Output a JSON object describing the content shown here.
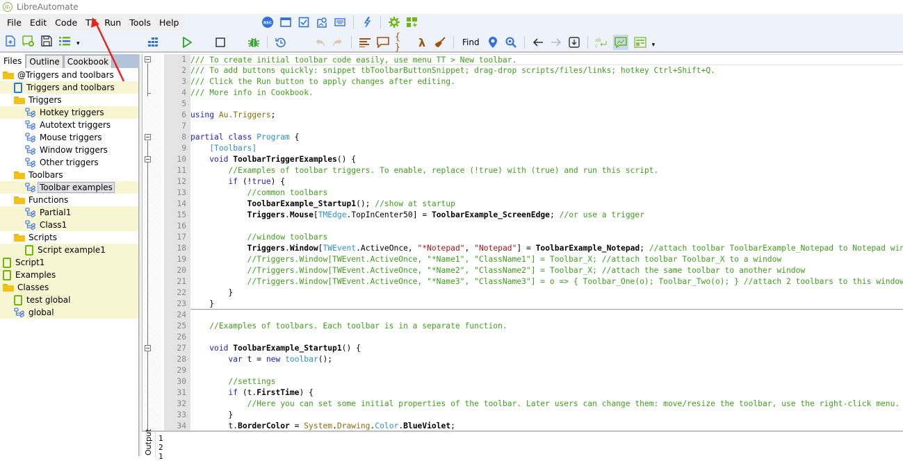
{
  "app": {
    "title": "LibreAutomate",
    "logo_text": "//."
  },
  "menu": [
    "File",
    "Edit",
    "Code",
    "TT",
    "Run",
    "Tools",
    "Help"
  ],
  "rec_toolbar": [
    {
      "name": "record-icon",
      "label": "REC"
    },
    {
      "name": "window-icon"
    },
    {
      "name": "checkbox-icon"
    },
    {
      "name": "image-search-icon"
    },
    {
      "name": "keyboard-icon"
    },
    {
      "name": "trigger-lightning-icon"
    },
    {
      "name": "settings-gear-icon"
    },
    {
      "name": "triggers-icon"
    }
  ],
  "toolbar": {
    "find_label": "Find"
  },
  "left_tabs": [
    "Files",
    "Outline",
    "Cookbook"
  ],
  "tree": [
    {
      "label": "@Triggers and toolbars",
      "type": "folder",
      "level": 0,
      "hl": false
    },
    {
      "label": "Triggers and toolbars",
      "type": "script-blue",
      "level": 1,
      "hl": true
    },
    {
      "label": "Triggers",
      "type": "folder",
      "level": 1,
      "hl": false
    },
    {
      "label": "Hotkey triggers",
      "type": "class",
      "level": 2,
      "hl": true
    },
    {
      "label": "Autotext triggers",
      "type": "class",
      "level": 2,
      "hl": false
    },
    {
      "label": "Mouse triggers",
      "type": "class",
      "level": 2,
      "hl": false
    },
    {
      "label": "Window triggers",
      "type": "class",
      "level": 2,
      "hl": false
    },
    {
      "label": "Other triggers",
      "type": "class",
      "level": 2,
      "hl": false
    },
    {
      "label": "Toolbars",
      "type": "folder",
      "level": 1,
      "hl": false
    },
    {
      "label": "Toolbar examples",
      "type": "class",
      "level": 2,
      "hl": true,
      "selected": true
    },
    {
      "label": "Functions",
      "type": "folder",
      "level": 1,
      "hl": false
    },
    {
      "label": "Partial1",
      "type": "class",
      "level": 2,
      "hl": true
    },
    {
      "label": "Class1",
      "type": "class",
      "level": 2,
      "hl": true
    },
    {
      "label": "Scripts",
      "type": "folder",
      "level": 1,
      "hl": false
    },
    {
      "label": "Script example1",
      "type": "script",
      "level": 2,
      "hl": true
    },
    {
      "label": "Script1",
      "type": "script",
      "level": 0,
      "hl": true
    },
    {
      "label": "Examples",
      "type": "script",
      "level": 0,
      "hl": true
    },
    {
      "label": "Classes",
      "type": "folder",
      "level": 0,
      "hl": true
    },
    {
      "label": "test global",
      "type": "script",
      "level": 1,
      "hl": true
    },
    {
      "label": "global",
      "type": "class",
      "level": 1,
      "hl": true
    }
  ],
  "code_lines": [
    [
      [
        "cmt",
        "/// To create initial toolbar code easily, use menu TT > New toolbar."
      ]
    ],
    [
      [
        "cmt",
        "/// To add buttons quickly: snippet tbToolbarButtonSnippet; drag-drop scripts/files/links; hotkey Ctrl+Shift+Q."
      ]
    ],
    [
      [
        "cmt",
        "/// Click the Run button to apply changes after editing."
      ]
    ],
    [
      [
        "cmt",
        "/// More info in Cookbook."
      ]
    ],
    [],
    [
      [
        "kw",
        "using "
      ],
      [
        "ty2",
        "Au.Triggers"
      ],
      [
        "dk",
        ";"
      ]
    ],
    [],
    [
      [
        "kw",
        "partial class "
      ],
      [
        "ty",
        "Program"
      ],
      [
        "dk",
        " {"
      ]
    ],
    [
      [
        "dk",
        "    "
      ],
      [
        "ty",
        "[Toolbars]"
      ]
    ],
    [
      [
        "dk",
        "    "
      ],
      [
        "kw",
        "void "
      ],
      [
        "b",
        "ToolbarTriggerExamples"
      ],
      [
        "dk",
        "() {"
      ]
    ],
    [
      [
        "dk",
        "        "
      ],
      [
        "cmt",
        "//Examples of toolbar triggers. To enable, replace (!true) with (true) and run this script."
      ]
    ],
    [
      [
        "dk",
        "        "
      ],
      [
        "kw",
        "if "
      ],
      [
        "dk",
        "(!"
      ],
      [
        "kw",
        "true"
      ],
      [
        "dk",
        ") {"
      ]
    ],
    [
      [
        "dk",
        "            "
      ],
      [
        "cmt",
        "//common toolbars"
      ]
    ],
    [
      [
        "dk",
        "            "
      ],
      [
        "b",
        "ToolbarExample_Startup1"
      ],
      [
        "dk",
        "(); "
      ],
      [
        "cmt",
        "//show at startup"
      ]
    ],
    [
      [
        "dk",
        "            "
      ],
      [
        "b",
        "Triggers"
      ],
      [
        "dk",
        "."
      ],
      [
        "b",
        "Mouse"
      ],
      [
        "dk",
        "["
      ],
      [
        "ty",
        "TMEdge"
      ],
      [
        "dk",
        "."
      ],
      [
        "ty2",
        "TopInCenter50"
      ],
      [
        "dk",
        "] = "
      ],
      [
        "b",
        "ToolbarExample_ScreenEdge"
      ],
      [
        "dk",
        "; "
      ],
      [
        "cmt",
        "//or use a trigger"
      ]
    ],
    [],
    [
      [
        "dk",
        "            "
      ],
      [
        "cmt",
        "//window toolbars"
      ]
    ],
    [
      [
        "dk",
        "            "
      ],
      [
        "b",
        "Triggers"
      ],
      [
        "dk",
        "."
      ],
      [
        "b",
        "Window"
      ],
      [
        "dk",
        "["
      ],
      [
        "ty",
        "TWEvent"
      ],
      [
        "dk",
        "."
      ],
      [
        "ty2",
        "ActiveOnce"
      ],
      [
        "dk",
        ", "
      ],
      [
        "str",
        "\"*Notepad\""
      ],
      [
        "dk",
        ", "
      ],
      [
        "str",
        "\"Notepad\""
      ],
      [
        "dk",
        "] = "
      ],
      [
        "b",
        "ToolbarExample_Notepad"
      ],
      [
        "dk",
        "; "
      ],
      [
        "cmt",
        "//attach toolbar ToolbarExample_Notepad to Notepad window"
      ]
    ],
    [
      [
        "dk",
        "            "
      ],
      [
        "cmt",
        "//Triggers.Window[TWEvent.ActiveOnce, \"*Name1\", \"ClassName1\"] = Toolbar_X; //attach toolbar Toolbar_X to a window"
      ]
    ],
    [
      [
        "dk",
        "            "
      ],
      [
        "cmt",
        "//Triggers.Window[TWEvent.ActiveOnce, \"*Name2\", \"ClassName2\"] = Toolbar_X; //attach the same toolbar to another window"
      ]
    ],
    [
      [
        "dk",
        "            "
      ],
      [
        "cmt",
        "//Triggers.Window[TWEvent.ActiveOnce, \"*Name3\", \"ClassName3\"] = o => { Toolbar_One(o); Toolbar_Two(o); } //attach 2 toolbars to this window"
      ]
    ],
    [
      [
        "dk",
        "        }"
      ]
    ],
    [
      [
        "dk",
        "    }"
      ]
    ],
    [],
    [
      [
        "dk",
        "    "
      ],
      [
        "cmt",
        "//Examples of toolbars. Each toolbar is in a separate function."
      ]
    ],
    [],
    [
      [
        "dk",
        "    "
      ],
      [
        "kw",
        "void "
      ],
      [
        "b",
        "ToolbarExample_Startup1"
      ],
      [
        "dk",
        "() {"
      ]
    ],
    [
      [
        "dk",
        "        "
      ],
      [
        "kw",
        "var "
      ],
      [
        "dk",
        "t = "
      ],
      [
        "kw",
        "new "
      ],
      [
        "ty",
        "toolbar"
      ],
      [
        "dk",
        "();"
      ]
    ],
    [],
    [
      [
        "dk",
        "        "
      ],
      [
        "cmt",
        "//settings"
      ]
    ],
    [
      [
        "dk",
        "        "
      ],
      [
        "kw",
        "if "
      ],
      [
        "dk",
        "(t."
      ],
      [
        "b",
        "FirstTime"
      ],
      [
        "dk",
        ") {"
      ]
    ],
    [
      [
        "dk",
        "            "
      ],
      [
        "cmt",
        "//Here you can set some initial properties of the toolbar. Later users can change them: move/resize the toolbar, use the right-click menu."
      ]
    ],
    [
      [
        "dk",
        "        }"
      ]
    ],
    [
      [
        "dk",
        "        t."
      ],
      [
        "b",
        "BorderColor"
      ],
      [
        "dk",
        " = "
      ],
      [
        "ty2",
        "System"
      ],
      [
        "dk",
        "."
      ],
      [
        "ty2",
        "Drawing"
      ],
      [
        "dk",
        "."
      ],
      [
        "ty",
        "Color"
      ],
      [
        "dk",
        "."
      ],
      [
        "b",
        "BlueViolet"
      ],
      [
        "dk",
        ";"
      ]
    ]
  ],
  "output": {
    "label": "Output",
    "lines": [
      "1",
      "2",
      "1"
    ]
  },
  "colors": {
    "comment": "#3f9e1c",
    "keyword": "#1b1bd8",
    "type": "#2b91c8",
    "string": "#a31515",
    "highlight": "#f8f6d2",
    "toolbar_bg": "#eef3fb",
    "annotation_arrow": "#e8221b"
  }
}
